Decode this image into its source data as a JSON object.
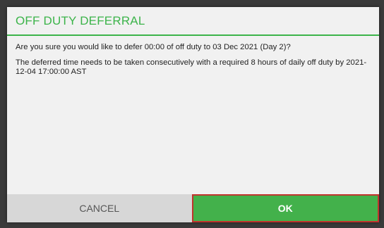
{
  "dialog": {
    "title": "OFF DUTY DEFERRAL",
    "message_1": "Are you sure you would like to defer 00:00 of off duty to 03 Dec 2021 (Day 2)?",
    "message_2": "The deferred time needs to be taken consecutively with a required 8 hours of daily off duty by 2021-12-04 17:00:00 AST",
    "cancel_label": "CANCEL",
    "ok_label": "OK"
  },
  "colors": {
    "accent": "#3cb44a",
    "ok_button": "#43b14b",
    "highlight_border": "#c0342d",
    "cancel_button": "#d7d7d7",
    "backdrop": "#3a3a3a"
  }
}
